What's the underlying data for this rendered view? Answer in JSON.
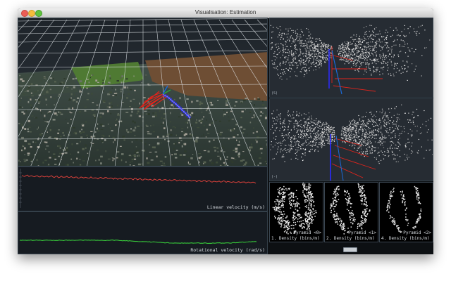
{
  "window": {
    "title": "Visualisation: Estimation"
  },
  "plots": {
    "linear_velocity": {
      "label": "Linear velocity (m/s)",
      "color": "#d8403a"
    },
    "rotational_velocity": {
      "label": "Rotational velocity (rad/s)",
      "color": "#37c83a"
    }
  },
  "views": {
    "top_depth": {
      "corner_label": "(S)"
    },
    "bottom_depth": {
      "corner_label": "(-)"
    }
  },
  "pyramids": [
    {
      "title": "Pyramid <0>",
      "caption": "1. Density (bins/m)"
    },
    {
      "title": "Pyramid <1>",
      "caption": "2. Density (bins/m)"
    },
    {
      "title": "Pyramid <2>",
      "caption": "4. Density (bins/m)"
    }
  ],
  "colors": {
    "trajectory": "#2b2bff",
    "frustum": "#e0241c",
    "axis_blue": "#1a6ad8"
  }
}
